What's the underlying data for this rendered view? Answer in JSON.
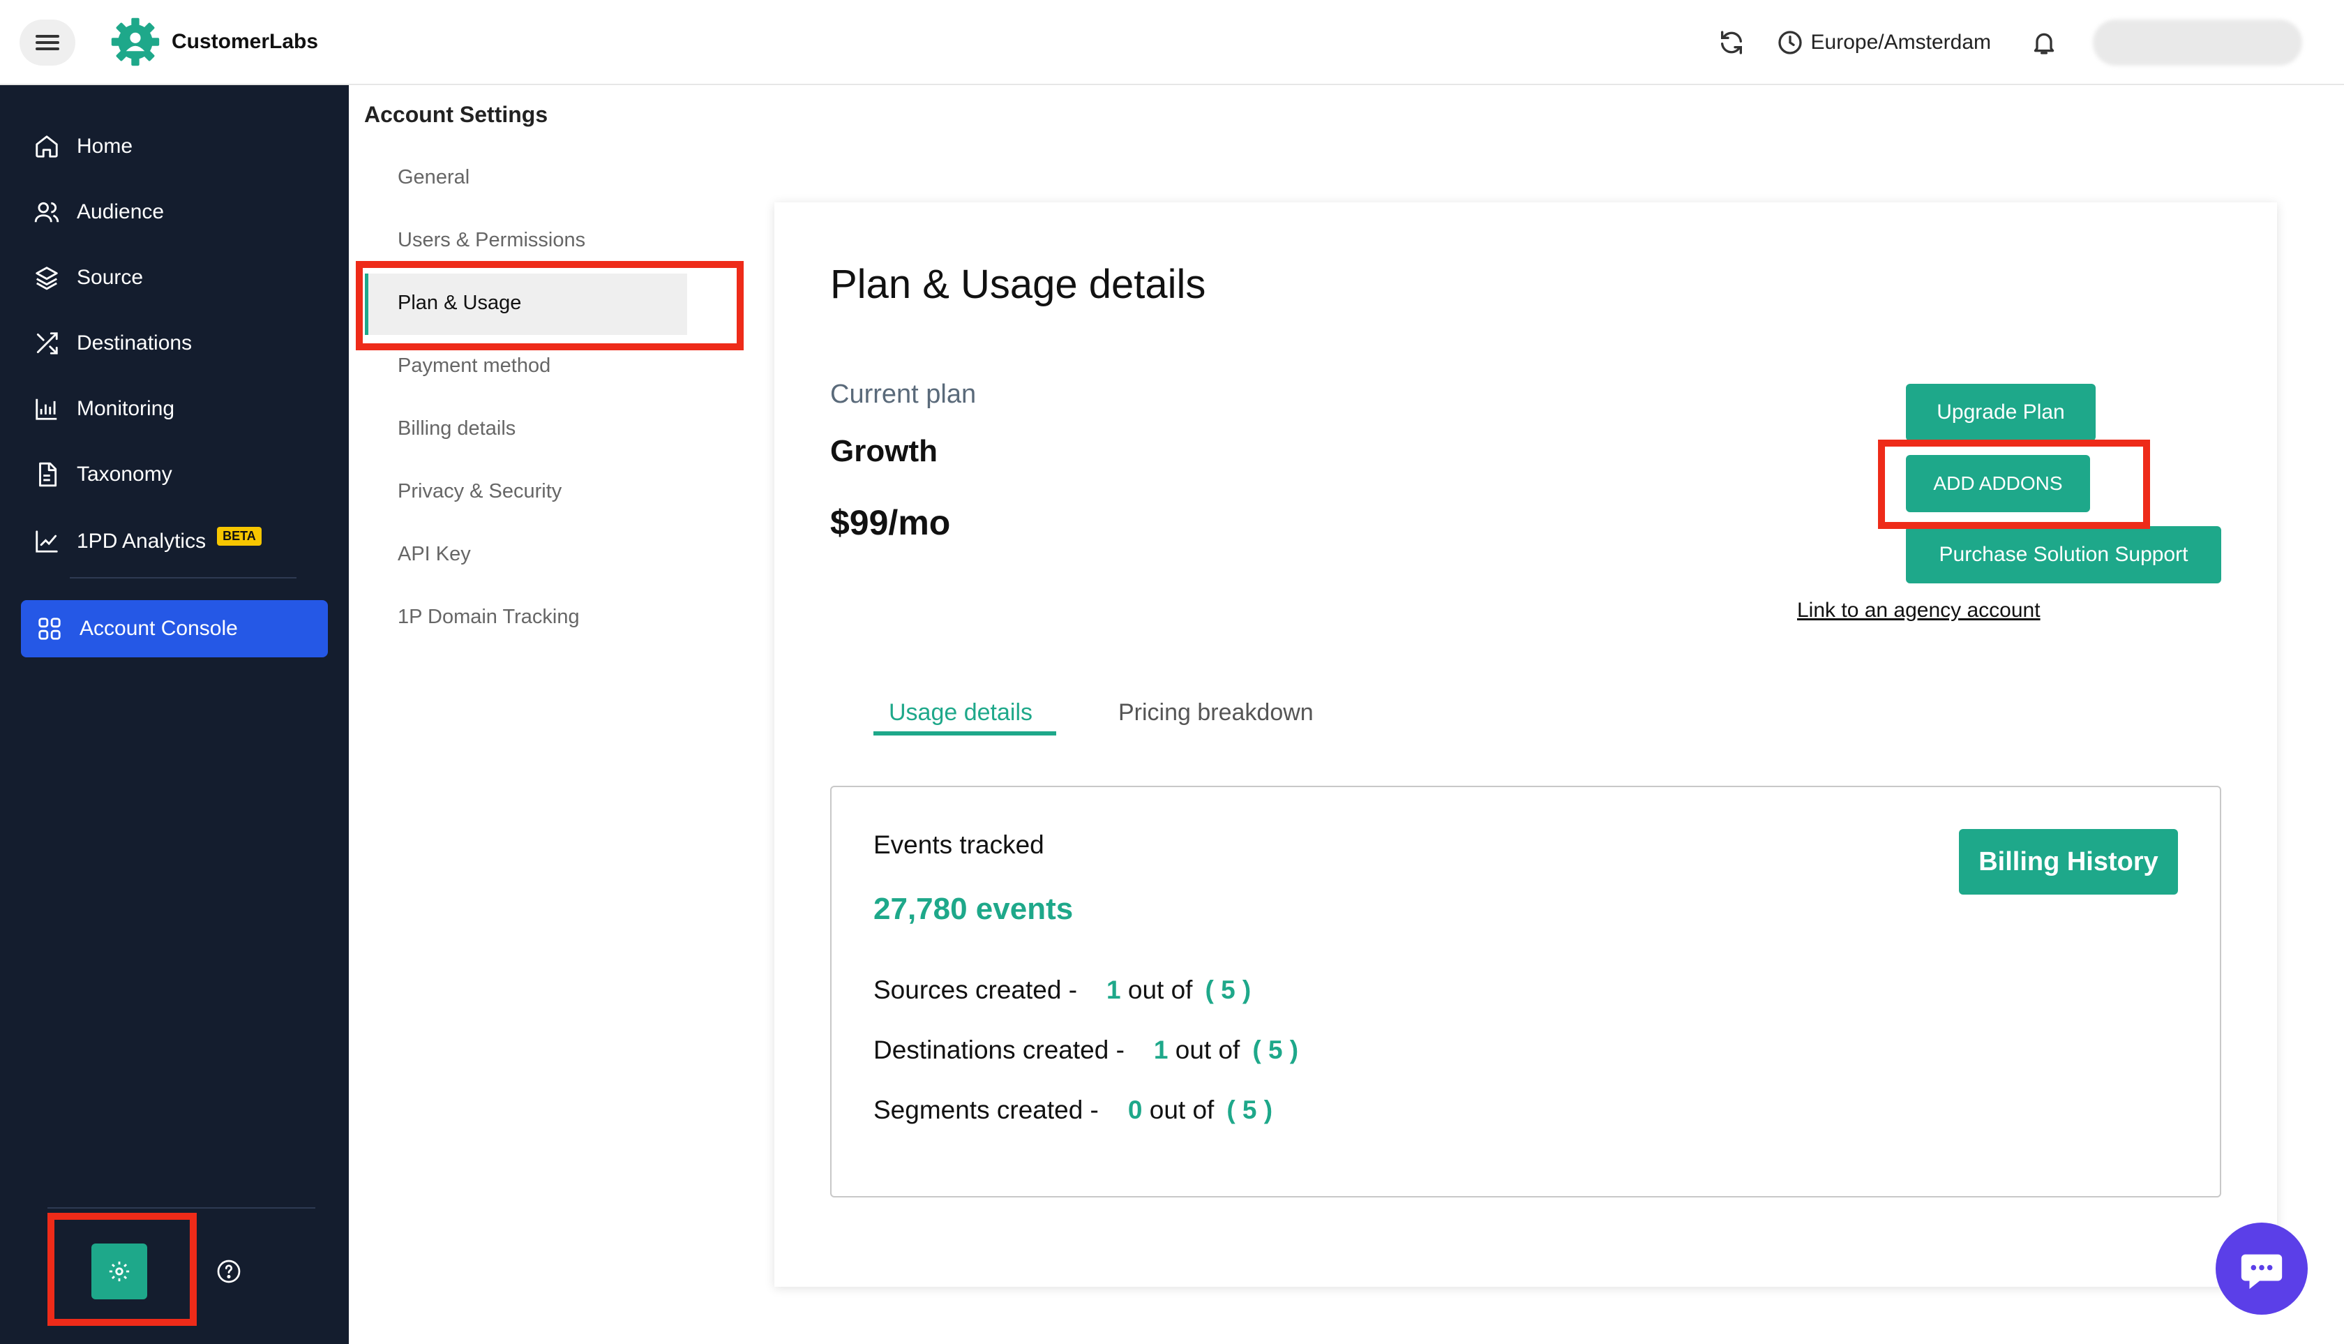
{
  "app": {
    "name": "CustomerLabs"
  },
  "header": {
    "timezone": "Europe/Amsterdam"
  },
  "sidebar": {
    "items": [
      {
        "label": "Home",
        "icon": "home-icon"
      },
      {
        "label": "Audience",
        "icon": "users-icon"
      },
      {
        "label": "Source",
        "icon": "layers-icon"
      },
      {
        "label": "Destinations",
        "icon": "shuffle-icon"
      },
      {
        "label": "Monitoring",
        "icon": "chart-icon"
      },
      {
        "label": "Taxonomy",
        "icon": "document-icon"
      },
      {
        "label": "1PD Analytics",
        "icon": "trend-icon",
        "badge": "BETA"
      }
    ],
    "active": {
      "label": "Account Console",
      "icon": "grid-icon"
    }
  },
  "settings_menu": {
    "title": "Account Settings",
    "items": [
      "General",
      "Users & Permissions",
      "Plan & Usage",
      "Payment method",
      "Billing details",
      "Privacy & Security",
      "API Key",
      "1P Domain Tracking"
    ],
    "active_index": 2
  },
  "plan": {
    "title": "Plan & Usage details",
    "current_plan_label": "Current plan",
    "name": "Growth",
    "price": "$99/mo",
    "upgrade_label": "Upgrade Plan",
    "addons_label": "ADD ADDONS",
    "support_label": "Purchase Solution Support",
    "agency_link": "Link to an agency account"
  },
  "tabs": [
    {
      "label": "Usage details",
      "active": true
    },
    {
      "label": "Pricing breakdown",
      "active": false
    }
  ],
  "usage": {
    "events_label": "Events tracked",
    "events_value": "27,780 events",
    "billing_history_label": "Billing History",
    "rows": [
      {
        "label": "Sources created -",
        "count": "1",
        "of": "out of",
        "limit": "( 5 )"
      },
      {
        "label": "Destinations created -",
        "count": "1",
        "of": "out of",
        "limit": "( 5 )"
      },
      {
        "label": "Segments created -",
        "count": "0",
        "of": "out of",
        "limit": "( 5 )"
      }
    ]
  },
  "colors": {
    "accent": "#1ea88a",
    "sidebar_bg": "#141d2e",
    "active_nav": "#2558e6",
    "annotation": "#ee2b19",
    "chat": "#5b3fe8"
  }
}
